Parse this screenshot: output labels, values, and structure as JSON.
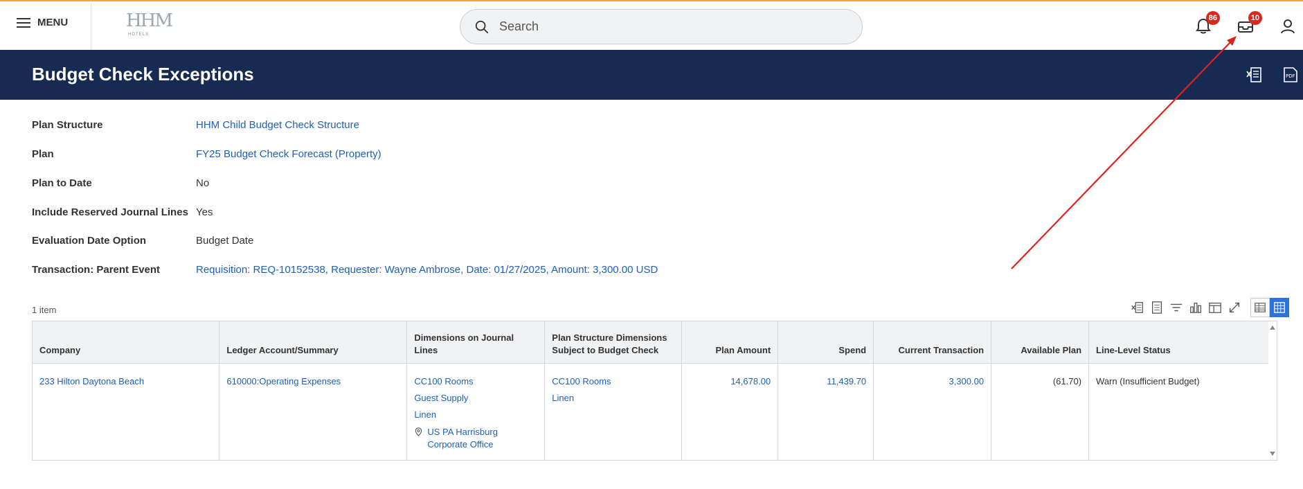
{
  "topbar": {
    "menu_label": "MENU",
    "logo_mark": "HHM",
    "logo_sub": "HOTELS",
    "search_placeholder": "Search",
    "notifications_badge": "86",
    "inbox_badge": "10"
  },
  "page": {
    "title": "Budget Check Exceptions"
  },
  "fields": [
    {
      "label": "Plan Structure",
      "value": "HHM Child Budget Check Structure"
    },
    {
      "label": "Plan",
      "value": "FY25 Budget Check Forecast (Property)"
    },
    {
      "label": "Plan to Date",
      "value": "No"
    },
    {
      "label": "Include Reserved Journal Lines",
      "value": "Yes"
    },
    {
      "label": "Evaluation Date Option",
      "value": "Budget Date"
    },
    {
      "label": "Transaction: Parent Event",
      "value": "Requisition: REQ-10152538, Requester: Wayne Ambrose, Date: 01/27/2025, Amount: 3,300.00 USD"
    }
  ],
  "table": {
    "count": "1 item",
    "headers": {
      "company": "Company",
      "ledger": "Ledger Account/Summary",
      "dims_journal": "Dimensions on Journal Lines",
      "plan_dims": "Plan Structure Dimensions Subject to Budget Check",
      "plan_amount": "Plan Amount",
      "spend": "Spend",
      "current_txn": "Current Transaction",
      "available": "Available Plan",
      "status": "Line-Level Status"
    },
    "row": {
      "company": "233 Hilton Daytona Beach",
      "ledger": "610000:Operating Expenses",
      "dims_journal": [
        "CC100 Rooms",
        "Guest Supply",
        "Linen"
      ],
      "location": "US PA Harrisburg Corporate Office",
      "plan_dims": [
        "CC100 Rooms",
        "Linen"
      ],
      "plan_amount": "14,678.00",
      "spend": "11,439.70",
      "current_txn": "3,300.00",
      "available": "(61.70)",
      "status": "Warn (Insufficient Budget)"
    }
  },
  "colors": {
    "header_bg": "#172a52",
    "link": "#1f5fb8",
    "badge": "#d42a1f",
    "annotation": "#e0211a"
  }
}
